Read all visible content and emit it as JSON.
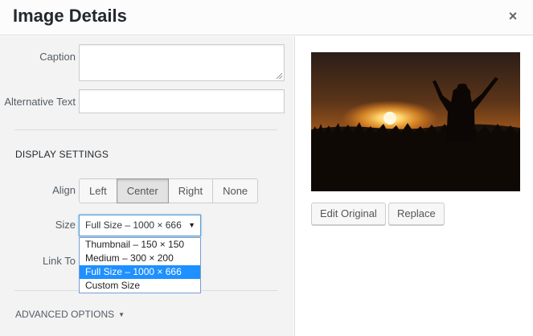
{
  "modal": {
    "title": "Image Details",
    "close_glyph": "×"
  },
  "form": {
    "caption_label": "Caption",
    "caption_value": "",
    "alt_label": "Alternative Text",
    "alt_value": ""
  },
  "display_settings": {
    "title": "DISPLAY SETTINGS",
    "align_label": "Align",
    "align_options": [
      "Left",
      "Center",
      "Right",
      "None"
    ],
    "align_selected": "Center",
    "size_label": "Size",
    "size_selected": "Full Size – 1000 × 666",
    "size_arrow": "▼",
    "size_options": [
      "Thumbnail – 150 × 150",
      "Medium – 300 × 200",
      "Full Size – 1000 × 666",
      "Custom Size"
    ],
    "link_label": "Link To"
  },
  "advanced": {
    "label": "ADVANCED OPTIONS",
    "arrow": "▼"
  },
  "preview": {
    "edit_label": "Edit Original",
    "replace_label": "Replace"
  },
  "colors": {
    "accent": "#1e90ff",
    "panel_bg": "#f3f3f3"
  },
  "icons": {
    "close": "close-icon",
    "dropdown": "chevron-down-icon"
  }
}
